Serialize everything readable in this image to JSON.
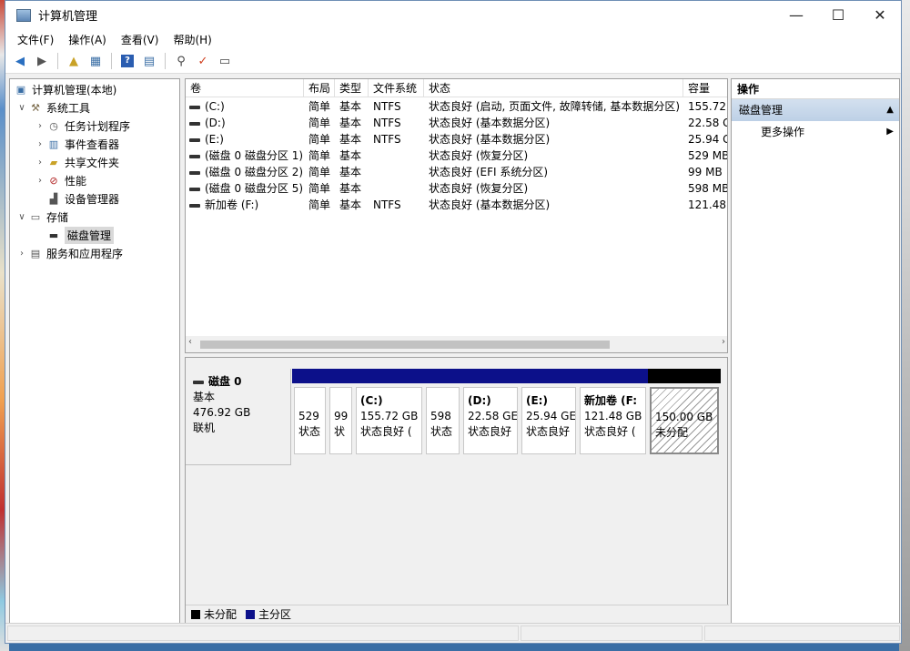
{
  "window": {
    "title": "计算机管理"
  },
  "window_controls": {
    "minimize": "—",
    "maximize": "☐",
    "close": "✕"
  },
  "menu": [
    "文件(F)",
    "操作(A)",
    "查看(V)",
    "帮助(H)"
  ],
  "tree": {
    "root": "计算机管理(本地)",
    "system_tools": "系统工具",
    "task_scheduler": "任务计划程序",
    "event_viewer": "事件查看器",
    "shared_folders": "共享文件夹",
    "performance": "性能",
    "device_manager": "设备管理器",
    "storage": "存储",
    "disk_management": "磁盘管理",
    "services": "服务和应用程序"
  },
  "volumes": {
    "columns": [
      "卷",
      "布局",
      "类型",
      "文件系统",
      "状态",
      "容量"
    ],
    "rows": [
      [
        "(C:)",
        "简单",
        "基本",
        "NTFS",
        "状态良好 (启动, 页面文件, 故障转储, 基本数据分区)",
        "155.72"
      ],
      [
        "(D:)",
        "简单",
        "基本",
        "NTFS",
        "状态良好 (基本数据分区)",
        "22.58 G"
      ],
      [
        "(E:)",
        "简单",
        "基本",
        "NTFS",
        "状态良好 (基本数据分区)",
        "25.94 G"
      ],
      [
        "(磁盘 0 磁盘分区 1)",
        "简单",
        "基本",
        "",
        "状态良好 (恢复分区)",
        "529 MB"
      ],
      [
        "(磁盘 0 磁盘分区 2)",
        "简单",
        "基本",
        "",
        "状态良好 (EFI 系统分区)",
        "99 MB"
      ],
      [
        "(磁盘 0 磁盘分区 5)",
        "简单",
        "基本",
        "",
        "状态良好 (恢复分区)",
        "598 MB"
      ],
      [
        "新加卷 (F:)",
        "简单",
        "基本",
        "NTFS",
        "状态良好 (基本数据分区)",
        "121.48"
      ]
    ]
  },
  "disk0": {
    "name": "磁盘 0",
    "type": "基本",
    "size": "476.92 GB",
    "status": "联机"
  },
  "partitions": [
    {
      "label": "",
      "size": "529",
      "status": "状态"
    },
    {
      "label": "",
      "size": "99",
      "status": "状"
    },
    {
      "label": "(C:)",
      "size": "155.72 GB",
      "status": "状态良好 ("
    },
    {
      "label": "",
      "size": "598",
      "status": "状态"
    },
    {
      "label": "(D:)",
      "size": "22.58 GE",
      "status": "状态良好"
    },
    {
      "label": "(E:)",
      "size": "25.94 GE",
      "status": "状态良好"
    },
    {
      "label": "新加卷  (F:",
      "size": "121.48 GB",
      "status": "状态良好 ("
    },
    {
      "label": "",
      "size": "150.00 GB",
      "status": "未分配"
    }
  ],
  "legend": {
    "unallocated": "未分配",
    "primary": "主分区"
  },
  "actions": {
    "header": "操作",
    "section": "磁盘管理",
    "more": "更多操作"
  },
  "colors": {
    "primary_partition": "#0c108a",
    "unallocated": "#000000",
    "action_section": "#c7d7ea"
  }
}
